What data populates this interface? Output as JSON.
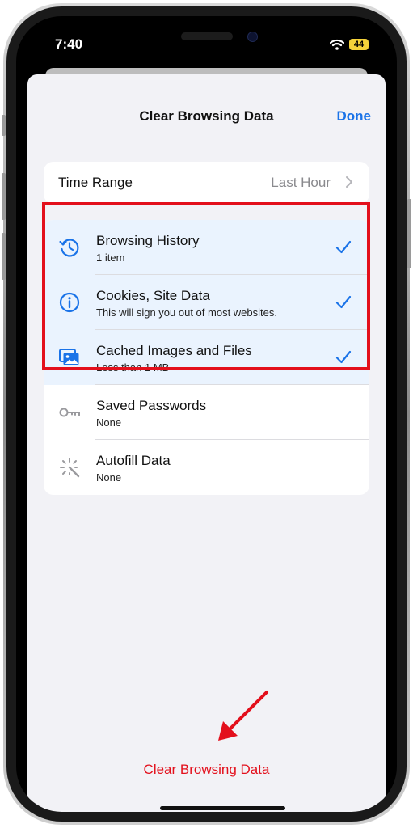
{
  "status_bar": {
    "time": "7:40",
    "battery": "44"
  },
  "header": {
    "title": "Clear Browsing Data",
    "done_label": "Done"
  },
  "time_range": {
    "label": "Time Range",
    "value": "Last Hour"
  },
  "data_items": [
    {
      "title": "Browsing History",
      "subtitle": "1 item",
      "checked": true,
      "icon": "history-icon"
    },
    {
      "title": "Cookies, Site Data",
      "subtitle": "This will sign you out of most websites.",
      "checked": true,
      "icon": "info-icon"
    },
    {
      "title": "Cached Images and Files",
      "subtitle": "Less than 1 MB",
      "checked": true,
      "icon": "images-icon"
    },
    {
      "title": "Saved Passwords",
      "subtitle": "None",
      "checked": false,
      "icon": "key-icon"
    },
    {
      "title": "Autofill Data",
      "subtitle": "None",
      "checked": false,
      "icon": "magic-wand-icon"
    }
  ],
  "clear_button": {
    "label": "Clear Browsing Data"
  },
  "colors": {
    "accent": "#1a73e8",
    "destructive": "#e3101c",
    "selected_row": "#eaf3fe",
    "annotation": "#e3101c"
  }
}
